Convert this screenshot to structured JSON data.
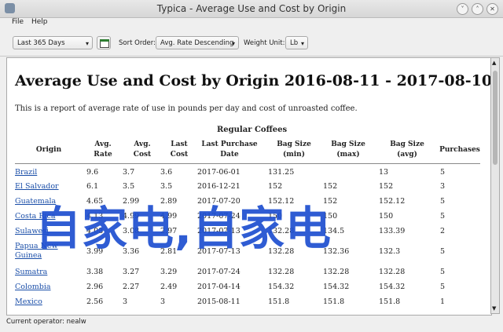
{
  "window": {
    "title": "Typica - Average Use and Cost by Origin"
  },
  "menu": {
    "file": "File",
    "help": "Help"
  },
  "toolbar": {
    "date_range": "Last 365 Days",
    "sort_label": "Sort Order:",
    "sort_value": "Avg. Rate Descending",
    "weight_label": "Weight Unit:",
    "weight_value": "Lb"
  },
  "report": {
    "title": "Average Use and Cost by Origin 2016-08-11 - 2017-08-10",
    "description": "This is a report of average rate of use in pounds per day and cost of unroasted coffee.",
    "table_title": "Regular Coffees",
    "columns": [
      "Origin",
      "Avg. Rate",
      "Avg. Cost",
      "Last Cost",
      "Last Purchase Date",
      "Bag Size (min)",
      "Bag Size (max)",
      "Bag Size (avg)",
      "Purchases"
    ],
    "rows": [
      [
        "Brazil",
        "9.6",
        "3.7",
        "3.6",
        "2017-06-01",
        "131.25",
        "",
        "13",
        "5"
      ],
      [
        "El Salvador",
        "6.1",
        "3.5",
        "3.5",
        "2016-12-21",
        "152",
        "152",
        "152",
        "3"
      ],
      [
        "Guatemala",
        "4.65",
        "2.99",
        "2.89",
        "2017-07-20",
        "152.12",
        "152",
        "152.12",
        "5"
      ],
      [
        "Costa Rica",
        "4.13",
        "4.99",
        "4.99",
        "2017-07-24",
        "150",
        "150",
        "150",
        "5"
      ],
      [
        "Sulawesi",
        "4.08",
        "3.08",
        "2.97",
        "2017-07-13",
        "132.28",
        "134.5",
        "133.39",
        "2"
      ],
      [
        "Papua New Guinea",
        "3.99",
        "3.36",
        "2.81",
        "2017-07-13",
        "132.28",
        "132.36",
        "132.3",
        "5"
      ],
      [
        "Sumatra",
        "3.38",
        "3.27",
        "3.29",
        "2017-07-24",
        "132.28",
        "132.28",
        "132.28",
        "5"
      ],
      [
        "Colombia",
        "2.96",
        "2.27",
        "2.49",
        "2017-04-14",
        "154.32",
        "154.32",
        "154.32",
        "5"
      ],
      [
        "Mexico",
        "2.56",
        "3",
        "3",
        "2015-08-11",
        "151.8",
        "151.8",
        "151.8",
        "1"
      ]
    ]
  },
  "watermark": "自家电,自家电",
  "status": {
    "operator": "Current operator: nealw"
  }
}
